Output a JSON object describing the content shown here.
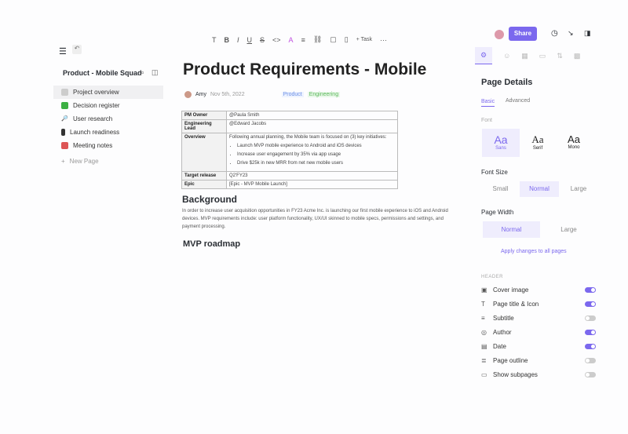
{
  "toolbar": {
    "text_style": "T",
    "bold": "B",
    "italic": "I",
    "underline": "U",
    "strike": "S",
    "code": "<>",
    "color": "A",
    "align": "≡",
    "task": "+ Task",
    "more": "···"
  },
  "sidebar": {
    "title": "Product - Mobile Squad",
    "items": [
      {
        "label": "Project overview"
      },
      {
        "label": "Decision register"
      },
      {
        "label": "User research"
      },
      {
        "label": "Launch readiness"
      },
      {
        "label": "Meeting notes"
      }
    ],
    "new_page": "New Page"
  },
  "doc": {
    "title": "Product Requirements - Mobile",
    "author": "Amy",
    "date": "Nov 5th, 2022",
    "tags": [
      "Product",
      "Engineering"
    ],
    "table": {
      "pm_owner_label": "PM Owner",
      "pm_owner": "@Paula Smith",
      "eng_lead_label": "Engineering Lead",
      "eng_lead": "@Edward Jacobs",
      "overview_label": "Overview",
      "overview": "Following annual planning, the Mobile team is focused on (3) key initiatives:",
      "bullets": [
        "Launch MVP mobile experience to Android and iOS devices",
        "Increase user engagement by 35% via app usage",
        "Drive $25k in new MRR from net new mobile users"
      ],
      "target_label": "Target release",
      "target": "Q2'FY23",
      "epic_label": "Epic",
      "epic": "[Epic - MVP Mobile Launch]"
    },
    "background_heading": "Background",
    "background_text": "In order to increase user acquisition opportunities in FY23 Acme Inc. is launching our first mobile experience to iOS and Android devices. MVP requirements include: user platform functionality, UX/UI skinned to mobile specs, permissions and settings, and payment processing.",
    "roadmap_heading": "MVP roadmap"
  },
  "header": {
    "share": "Share"
  },
  "panel": {
    "title": "Page Details",
    "tabs": [
      "Basic",
      "Advanced"
    ],
    "font_label": "Font",
    "fonts": [
      {
        "glyph": "Aa",
        "name": "Sans"
      },
      {
        "glyph": "Aa",
        "name": "Serif"
      },
      {
        "glyph": "Aa",
        "name": "Mono"
      }
    ],
    "font_size_label": "Font Size",
    "sizes": [
      "Small",
      "Normal",
      "Large"
    ],
    "width_label": "Page Width",
    "widths": [
      "Normal",
      "Large"
    ],
    "apply": "Apply changes to all pages",
    "section": "HEADER",
    "toggles": [
      {
        "label": "Cover image",
        "on": true,
        "icon": "▣"
      },
      {
        "label": "Page title & Icon",
        "on": true,
        "icon": "T"
      },
      {
        "label": "Subtitle",
        "on": false,
        "icon": "≡"
      },
      {
        "label": "Author",
        "on": true,
        "icon": "◎"
      },
      {
        "label": "Date",
        "on": true,
        "icon": "▤"
      },
      {
        "label": "Page outline",
        "on": false,
        "icon": "≣"
      },
      {
        "label": "Show subpages",
        "on": false,
        "icon": "▭"
      }
    ]
  },
  "colors": {
    "accent": "#7b68ee"
  }
}
